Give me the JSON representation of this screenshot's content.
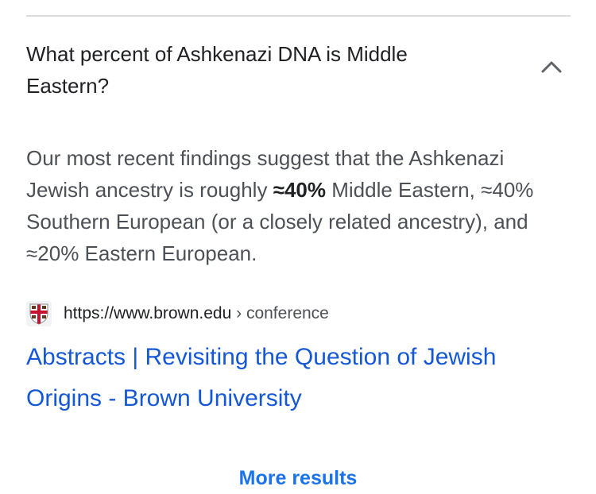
{
  "faq": {
    "question": "What percent of Ashkenazi DNA is Middle Eastern?",
    "expanded_icon": "chevron-up-icon",
    "answer": {
      "part1": "Our most recent findings suggest that the Ashkenazi Jewish ancestry is roughly ",
      "bold": "≈40%",
      "part2": " Middle Eastern, ≈40% Southern European (or a closely related ancestry), and ≈20% Eastern European."
    },
    "source": {
      "url": "https://www.brown.edu",
      "separator": " › ",
      "crumb": "conference",
      "favicon": "brown-university-shield-icon"
    },
    "result_title": "Abstracts | Revisiting the Question of Jewish Origins - Brown University"
  },
  "footer": {
    "more_results": "More results"
  },
  "colors": {
    "divider": "#dadce0",
    "question_text": "#202124",
    "answer_text": "#4d5156",
    "link": "#1558d6",
    "more_results": "#1a73e8",
    "shield_red": "#c8102e"
  }
}
